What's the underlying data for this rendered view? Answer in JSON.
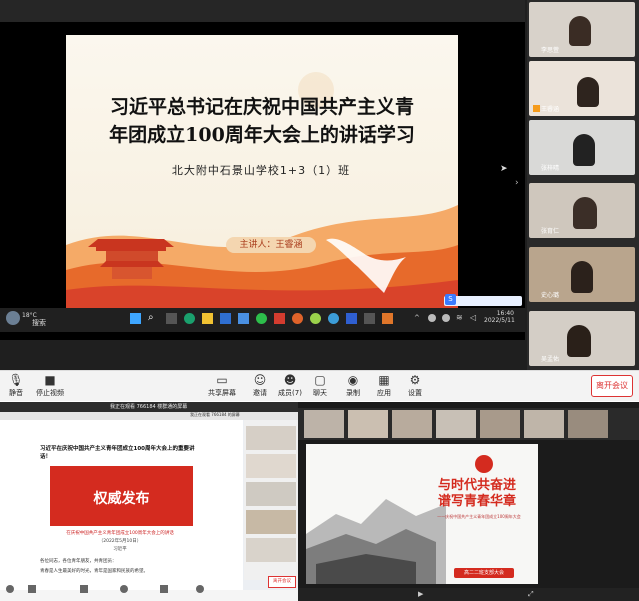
{
  "slide": {
    "title_line1": "习近平总书记在庆祝中国共产主义青",
    "title_line2": "年团成立100周年大会上的讲话学习",
    "subtitle": "北大附中石景山学校1+3（1）班",
    "speaker": "主讲人：王睿涵"
  },
  "taskbar": {
    "weather": "18°C",
    "search": "搜索",
    "time": "16:40",
    "date": "2022/5/11"
  },
  "participants": [
    {
      "name": "李思萱"
    },
    {
      "name": "王睿涵"
    },
    {
      "name": "张梓晴"
    },
    {
      "name": "张育仁"
    },
    {
      "name": "史心璐"
    },
    {
      "name": "吴孟佑"
    }
  ],
  "toolbar": {
    "mute": "静音",
    "stop_video": "停止视频",
    "share": "共享屏幕",
    "invite": "邀请",
    "participants": "成员(7)",
    "chat": "聊天",
    "record": "录制",
    "apps": "应用",
    "settings": "设置",
    "leave": "离开会议"
  },
  "bottom_left": {
    "tab1": "我正在观看 766184 楼群通的屏幕",
    "tab2": "我正在观看 766184 的屏幕",
    "article_title": "习近平在庆祝中国共产主义青年团成立100周年大会上的重要讲话！",
    "banner": "权威发布",
    "caption": "在庆祝中国共产主义青年团成立100周年大会上的讲话",
    "date": "（2022年5月10日）",
    "author": "习近平",
    "para1": "各位同志，各位青年朋友，共青团员：",
    "para2": "青春是人生最美好的时光，青年是国家和民族的希望。",
    "leave": "离开会议"
  },
  "bottom_right": {
    "slide_headline1": "与时代共奋进",
    "slide_headline2": "谱写青春华章",
    "slide_tagline": "——庆祝中国共产主义青年团成立100周年大会",
    "slide_button": "高二二班支部大会"
  },
  "colors": {
    "accent_red": "#d42b1f",
    "leave_red": "#dd3333",
    "slide_orange": "#f29a4a"
  }
}
